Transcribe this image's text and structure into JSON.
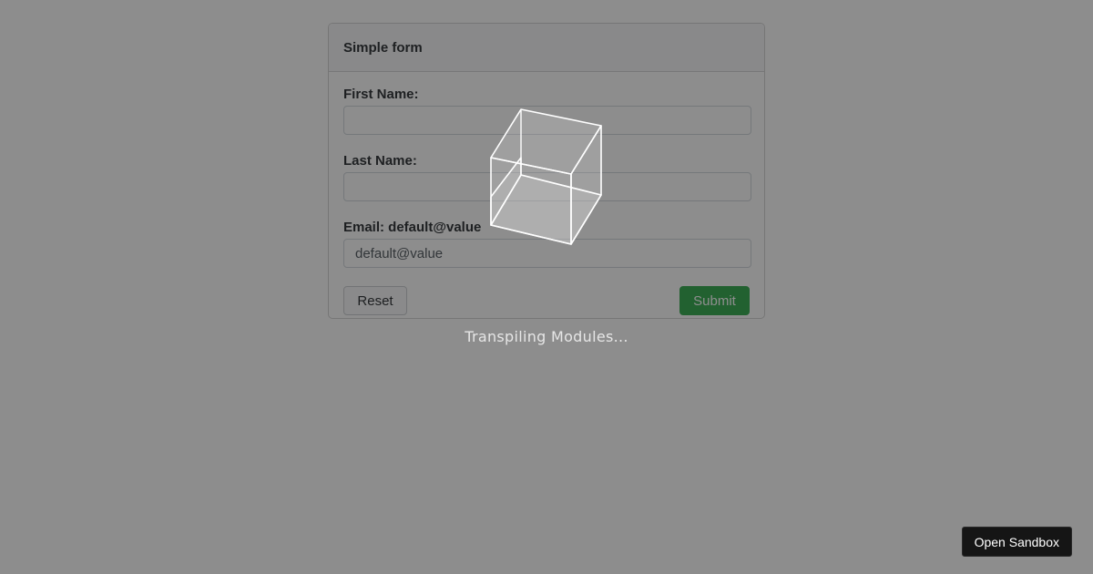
{
  "form": {
    "title": "Simple form",
    "fields": [
      {
        "label": "First Name:",
        "value": "",
        "placeholder": ""
      },
      {
        "label": "Last Name:",
        "value": "",
        "placeholder": ""
      },
      {
        "label": "Email: default@value",
        "value": "default@value",
        "placeholder": ""
      }
    ],
    "reset_label": "Reset",
    "submit_label": "Submit"
  },
  "overlay": {
    "loading_text": "Transpiling Modules...",
    "loader_icon": "cube-icon"
  },
  "sandbox": {
    "open_label": "Open Sandbox"
  },
  "colors": {
    "submit": "#28a745",
    "overlay": "#8c8c8c",
    "sandbox_button": "#151515"
  }
}
